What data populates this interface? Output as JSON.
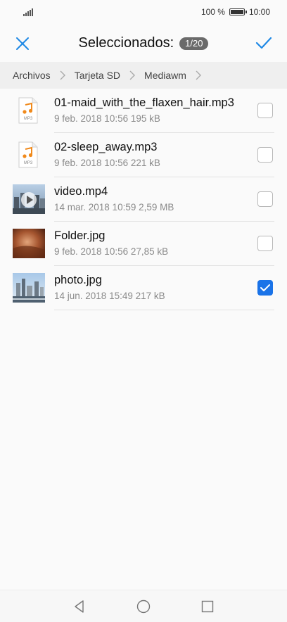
{
  "status": {
    "battery_text": "100 %",
    "time": "10:00"
  },
  "header": {
    "title": "Seleccionados:",
    "count": "1/20"
  },
  "breadcrumb": [
    "Archivos",
    "Tarjeta SD",
    "Mediawm"
  ],
  "files": [
    {
      "name": "01-maid_with_the_flaxen_hair.mp3",
      "meta": "9 feb. 2018 10:56 195 kB",
      "type": "mp3-icon",
      "checked": false,
      "mp3_label": "MP3"
    },
    {
      "name": "02-sleep_away.mp3",
      "meta": "9 feb. 2018 10:56 221 kB",
      "type": "mp3-icon",
      "checked": false,
      "mp3_label": "MP3"
    },
    {
      "name": "video.mp4",
      "meta": "14 mar. 2018 10:59 2,59 MB",
      "type": "video-thumbnail",
      "checked": false
    },
    {
      "name": "Folder.jpg",
      "meta": "9 feb. 2018 10:56 27,85 kB",
      "type": "image-thumbnail",
      "checked": false
    },
    {
      "name": "photo.jpg",
      "meta": "14 jun. 2018 15:49 217 kB",
      "type": "image-thumbnail",
      "checked": true
    }
  ],
  "colors": {
    "accent": "#1a73e8",
    "header_icon": "#1e88e5",
    "mp3_orange": "#f08a1c"
  }
}
